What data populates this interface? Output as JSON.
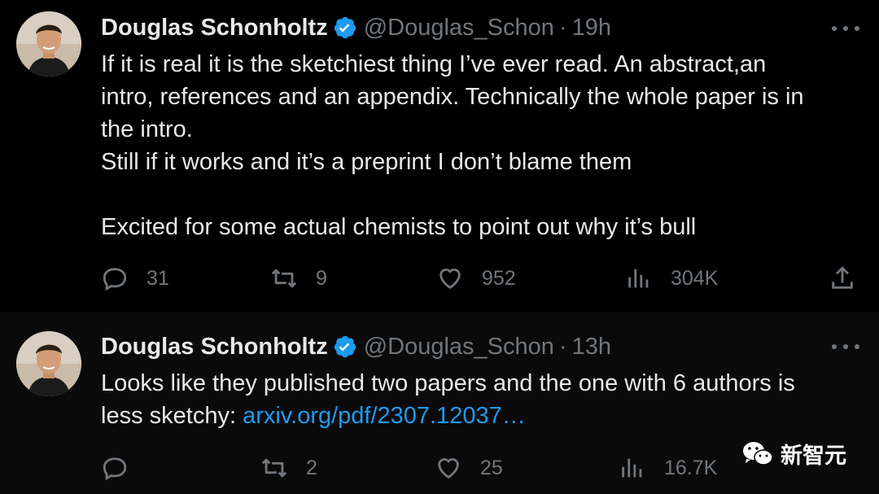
{
  "colors": {
    "background": "#000000",
    "text": "#e7e9ea",
    "muted": "#71767b",
    "link": "#1d9bf0",
    "verified": "#1d9bf0"
  },
  "tweets": [
    {
      "author": {
        "name": "Douglas Schonholtz",
        "handle": "@Douglas_Schon",
        "verified_icon": "verified-badge-icon"
      },
      "time": "19h",
      "lines": [
        "If it is real it is the sketchiest thing I’ve ever read. An abstract,an",
        "intro, references and an appendix. Technically the whole paper is in",
        "the intro.",
        "Still if it works and it’s a preprint I don’t blame them",
        "",
        "Excited for some actual chemists to point out why it’s bull"
      ],
      "stats": {
        "replies": "31",
        "retweets": "9",
        "likes": "952",
        "views": "304K"
      }
    },
    {
      "author": {
        "name": "Douglas Schonholtz",
        "handle": "@Douglas_Schon",
        "verified_icon": "verified-badge-icon"
      },
      "time": "13h",
      "line1": "Looks like they published two papers and the one with 6 authors is",
      "line2_prefix": "less sketchy: ",
      "link_text": "arxiv.org/pdf/2307.12037…",
      "stats": {
        "replies": "",
        "retweets": "2",
        "likes": "25",
        "views": "16.7K"
      }
    }
  ],
  "watermark": {
    "text": "新智元",
    "icon": "wechat-icon"
  },
  "separator": "·"
}
